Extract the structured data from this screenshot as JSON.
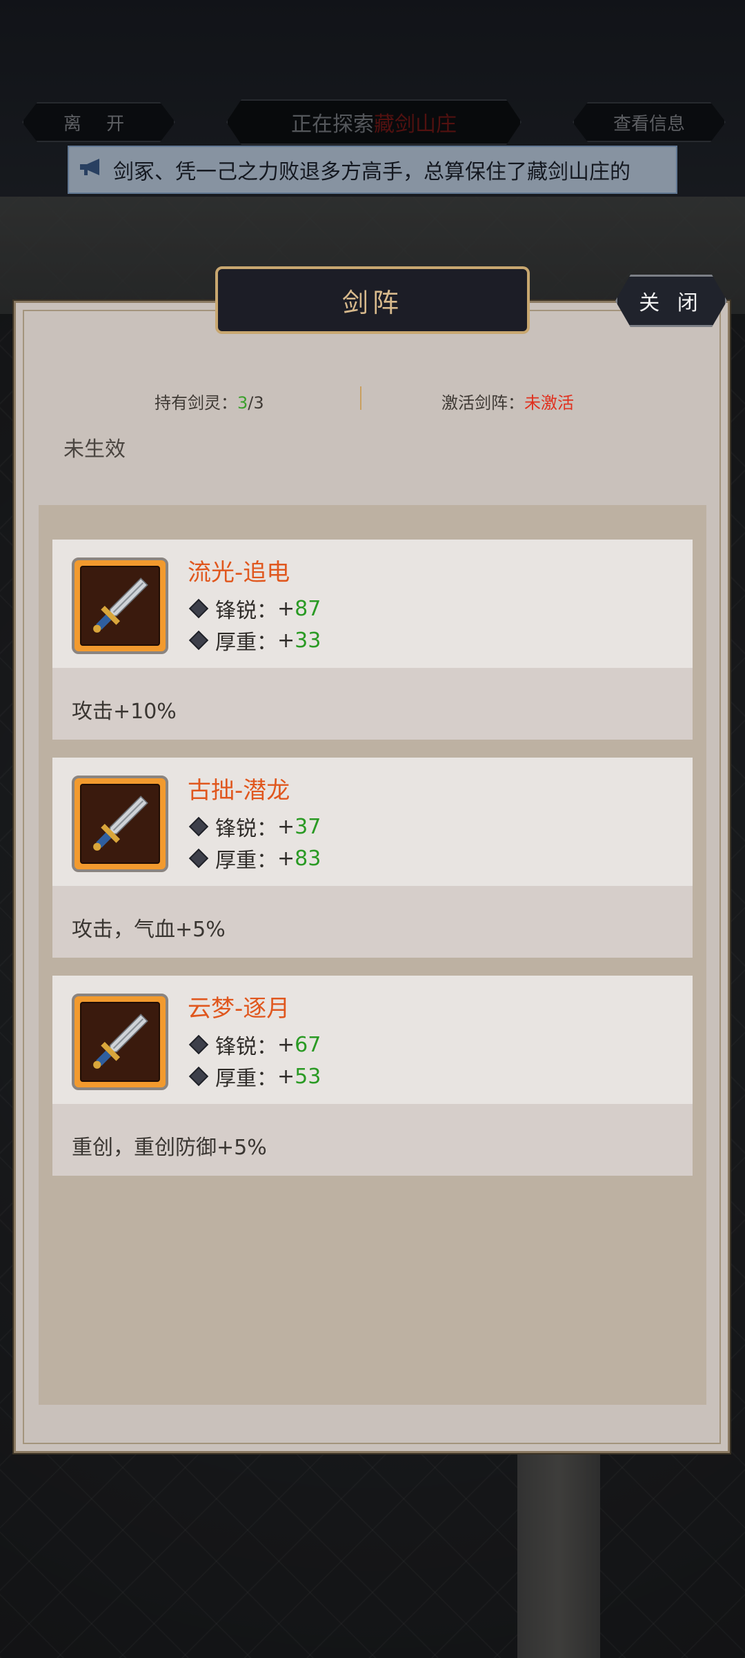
{
  "topbar": {
    "leave_label": "离 开",
    "explore_prefix": "正在探索",
    "explore_location": "藏剑山庄",
    "info_label": "查看信息"
  },
  "notice": {
    "text": "剑冢、凭一己之力败退多方高手，总算保住了藏剑山庄的",
    "icon": "megaphone-icon"
  },
  "panel": {
    "title": "剑阵",
    "close_label": "关 闭",
    "held_label": "持有剑灵：",
    "held_count": "3",
    "held_total": "/3",
    "activate_label": "激活剑阵：",
    "activate_state": "未激活",
    "effect_status": "未生效"
  },
  "swords": [
    {
      "name": "流光-追电",
      "stat1_label": "锋锐：",
      "stat1_value": "87",
      "stat2_label": "厚重：",
      "stat2_value": "33",
      "effect": "攻击+10%",
      "icon": "sword-icon"
    },
    {
      "name": "古拙-潜龙",
      "stat1_label": "锋锐：",
      "stat1_value": "37",
      "stat2_label": "厚重：",
      "stat2_value": "83",
      "effect": "攻击，气血+5%",
      "icon": "sword-icon"
    },
    {
      "name": "云梦-逐月",
      "stat1_label": "锋锐：",
      "stat1_value": "67",
      "stat2_label": "厚重：",
      "stat2_value": "53",
      "effect": "重创，重创防御+5%",
      "icon": "sword-icon"
    }
  ],
  "colors": {
    "name": "#e0571e",
    "stat_value": "#2a9a24",
    "inactive": "#e0301e",
    "title_text": "#d7b98c"
  }
}
